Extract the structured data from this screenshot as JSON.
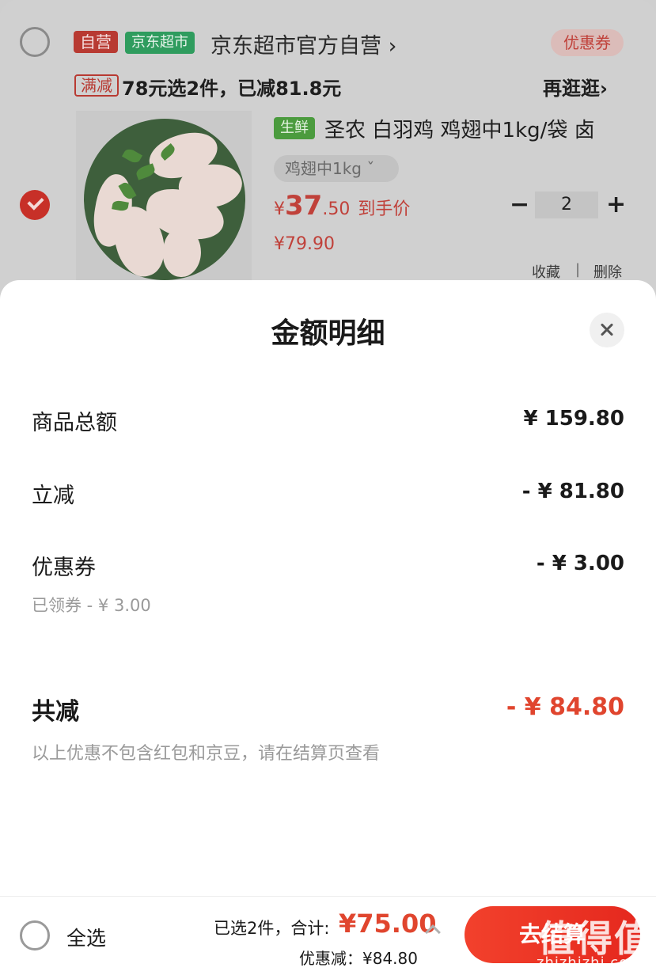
{
  "cart": {
    "store": {
      "self_tag": "自营",
      "brand_tag": "京东超市",
      "name": "京东超市官方自营 ›",
      "coupon_label": "优惠券"
    },
    "promo": {
      "tag": "满减",
      "text": "78元选2件，已减81.8元",
      "more_label": "再逛逛›"
    },
    "product": {
      "fresh_tag": "生鲜",
      "title": "圣农 白羽鸡 鸡翅中1kg/袋 卤",
      "spec": "鸡翅中1kg ˇ",
      "price_yen": "¥",
      "price_int": "37",
      "price_dec": ".50",
      "price_suffix": "到手价",
      "orig_price": "¥79.90",
      "qty_minus": "−",
      "qty": "2",
      "qty_plus": "+",
      "favorite_label": "收藏",
      "separator": "|",
      "delete_label": "删除",
      "checked": true
    }
  },
  "sheet": {
    "title": "金额明细",
    "rows": [
      {
        "label": "商品总额",
        "value": "¥ 159.80"
      },
      {
        "label": "立减",
        "value": "- ¥ 81.80"
      },
      {
        "label": "优惠券",
        "value": "- ¥ 3.00",
        "sub": "已领券 - ¥ 3.00"
      }
    ],
    "total_label": "共减",
    "total_value": "- ¥ 84.80",
    "note": "以上优惠不包含红包和京豆，请在结算页查看"
  },
  "bottom": {
    "select_all_label": "全选",
    "summary_text": "已选2件，合计:",
    "sum_price": "¥75.00",
    "discount_text": "优惠减：¥84.80",
    "checkout_label": "去结算"
  },
  "watermark": {
    "logo_text": "值得值",
    "url": "zhizhizhi.com"
  },
  "colors": {
    "accent_red": "#e0452e",
    "dim_red": "#c0413a",
    "store_green": "#2f9c5e"
  }
}
